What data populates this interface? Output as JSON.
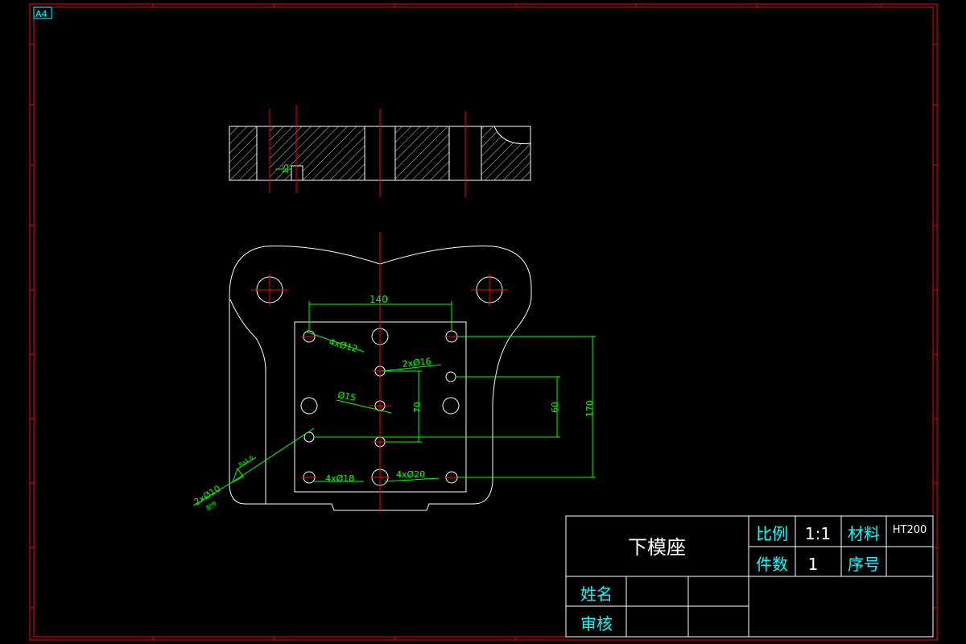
{
  "sheet": {
    "size_label": "A4",
    "colors": {
      "background": "#000000",
      "frame": "#ff0000",
      "outline": "#ffffff",
      "centerline": "#ff0000",
      "dimension": "#00ff00",
      "title_text": "#00ffff",
      "hatch": "#ffffff"
    }
  },
  "dimensions": {
    "width_140": "140",
    "hole_4x12": "4xØ12",
    "hole_2x16": "2xØ16",
    "hole_15": "Ø15",
    "dim_70": "70",
    "dim_60": "60",
    "dim_170": "170",
    "hole_4x18": "4xØ18",
    "hole_4x20": "4xØ20",
    "hole_2x10": "2xØ10",
    "hole_2x10_note": "配作",
    "roughness": "Ra1.6",
    "section_note": "15"
  },
  "title_block": {
    "part_name": "下模座",
    "scale_label": "比例",
    "scale_value": "1:1",
    "material_label": "材料",
    "material_value": "HT200",
    "quantity_label": "件数",
    "quantity_value": "1",
    "serial_label": "序号",
    "name_label": "姓名",
    "review_label": "审核"
  }
}
